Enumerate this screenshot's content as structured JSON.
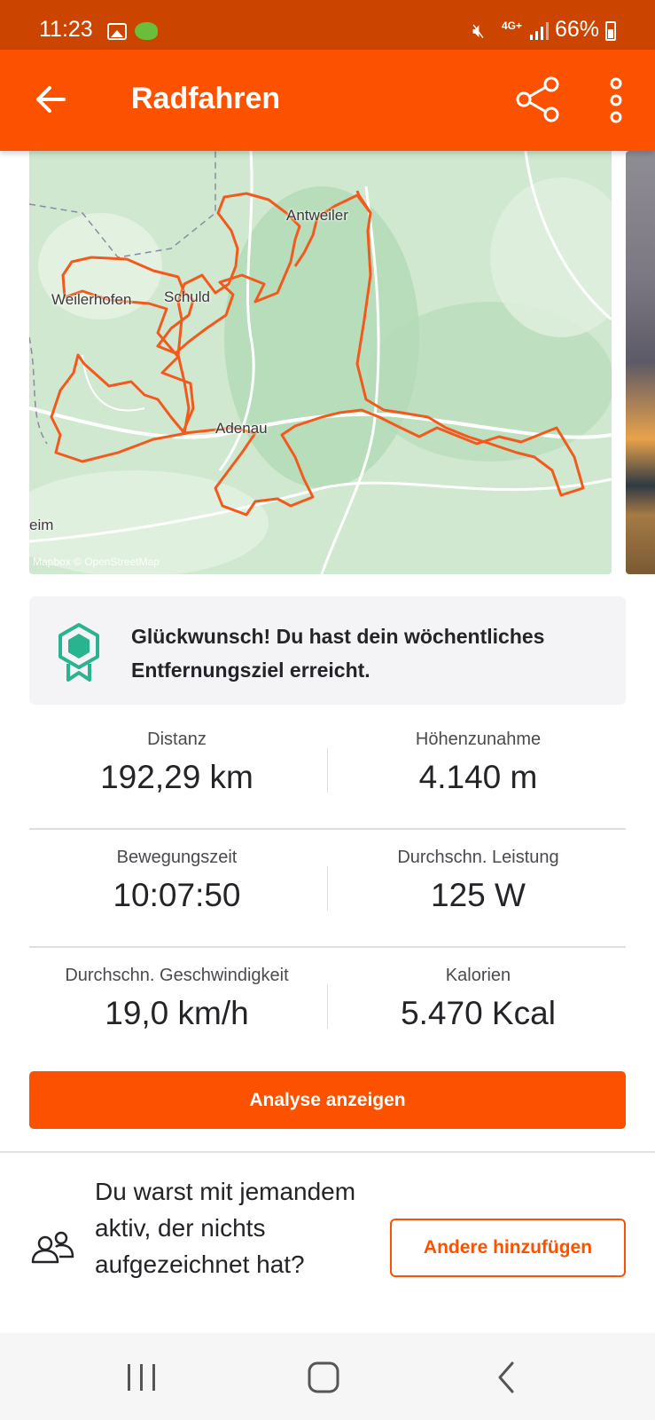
{
  "status_bar": {
    "time": "11:23",
    "network": "4G+",
    "battery": "66%"
  },
  "header": {
    "title": "Radfahren"
  },
  "map": {
    "places": [
      "Antweiler",
      "Weilerhofen",
      "Schuld",
      "Adenau",
      "eim"
    ],
    "attribution": "Mapbox © OpenStreetMap"
  },
  "goal": {
    "message": "Glückwunsch! Du hast dein wöchentliches Entfernungsziel erreicht."
  },
  "stats": [
    {
      "label": "Distanz",
      "value": "192,29 km"
    },
    {
      "label": "Höhenzunahme",
      "value": "4.140 m"
    },
    {
      "label": "Bewegungszeit",
      "value": "10:07:50"
    },
    {
      "label": "Durchschn. Leistung",
      "value": "125 W"
    },
    {
      "label": "Durchschn. Geschwindigkeit",
      "value": "19,0 km/h"
    },
    {
      "label": "Kalorien",
      "value": "5.470 Kcal"
    }
  ],
  "analysis_button": "Analyse anzeigen",
  "together": {
    "text": "Du warst mit jemandem aktiv, der nichts aufgezeichnet hat?",
    "button": "Andere hinzufügen"
  },
  "colors": {
    "brand": "#fc5200",
    "status_bar": "#cc4500",
    "route": "#f25a1d",
    "goal_badge": "#2ab38f"
  }
}
